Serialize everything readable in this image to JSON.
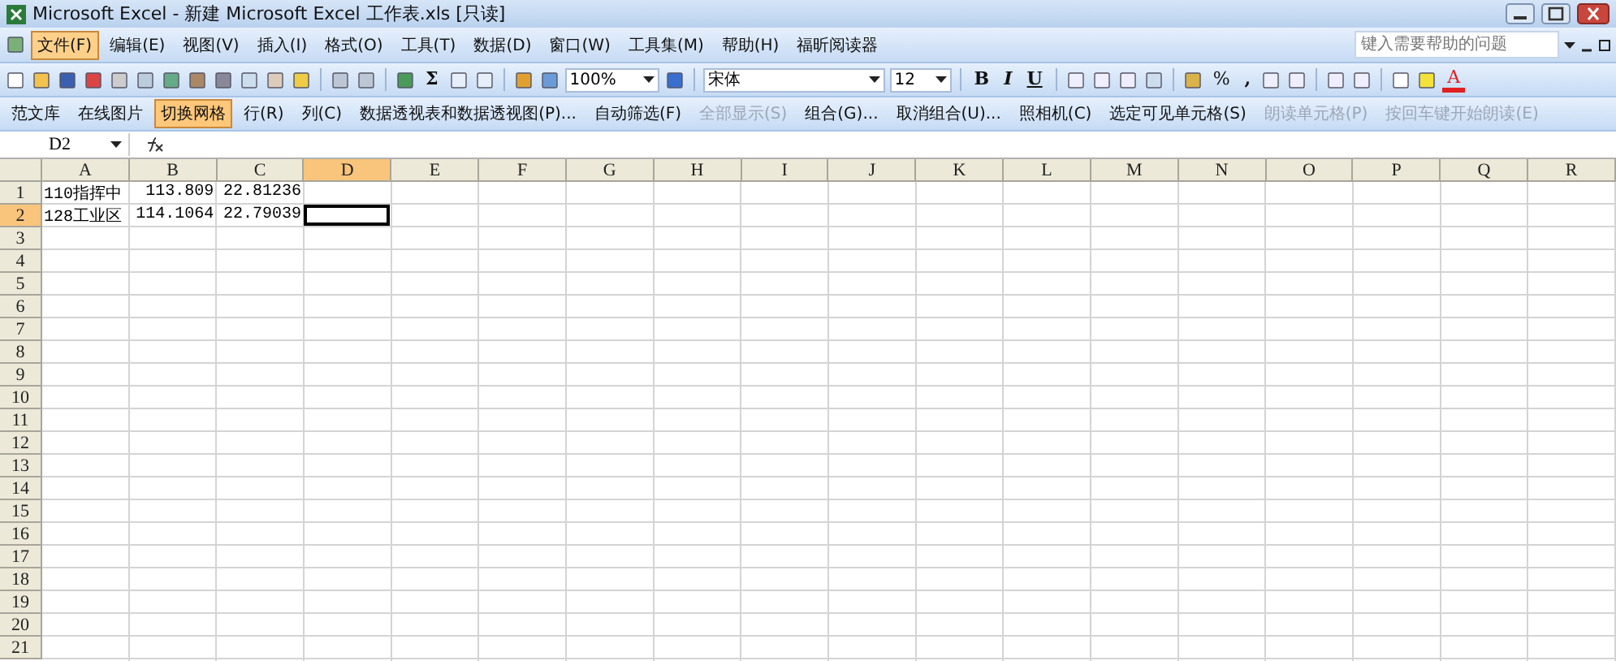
{
  "window": {
    "title": "Microsoft Excel - 新建 Microsoft Excel 工作表.xls  [只读]"
  },
  "menu": [
    {
      "label": "文件(F)",
      "selected": true
    },
    {
      "label": "编辑(E)",
      "selected": false
    },
    {
      "label": "视图(V)",
      "selected": false
    },
    {
      "label": "插入(I)",
      "selected": false
    },
    {
      "label": "格式(O)",
      "selected": false
    },
    {
      "label": "工具(T)",
      "selected": false
    },
    {
      "label": "数据(D)",
      "selected": false
    },
    {
      "label": "窗口(W)",
      "selected": false
    },
    {
      "label": "工具集(M)",
      "selected": false
    },
    {
      "label": "帮助(H)",
      "selected": false
    },
    {
      "label": "福昕阅读器",
      "selected": false
    }
  ],
  "help_search": {
    "placeholder": "键入需要帮助的问题"
  },
  "standard_toolbar": {
    "sum": "Σ",
    "zoom": "100%"
  },
  "formatting_toolbar": {
    "font": "宋体",
    "size": "12",
    "bold": "B",
    "italic": "I",
    "underline": "U",
    "percent": "%",
    "comma": ",",
    "font_color": "A"
  },
  "extra_toolbar": [
    {
      "label": "范文库",
      "selected": false,
      "disabled": false
    },
    {
      "label": "在线图片",
      "selected": false,
      "disabled": false
    },
    {
      "label": "切换网格",
      "selected": true,
      "disabled": false
    },
    {
      "label": "行(R)",
      "selected": false,
      "disabled": false
    },
    {
      "label": "列(C)",
      "selected": false,
      "disabled": false
    },
    {
      "label": "数据透视表和数据透视图(P)...",
      "selected": false,
      "disabled": false
    },
    {
      "label": "自动筛选(F)",
      "selected": false,
      "disabled": false
    },
    {
      "label": "全部显示(S)",
      "selected": false,
      "disabled": true
    },
    {
      "label": "组合(G)...",
      "selected": false,
      "disabled": false
    },
    {
      "label": "取消组合(U)...",
      "selected": false,
      "disabled": false
    },
    {
      "label": "照相机(C)",
      "selected": false,
      "disabled": false
    },
    {
      "label": "选定可见单元格(S)",
      "selected": false,
      "disabled": false
    },
    {
      "label": "朗读单元格(P)",
      "selected": false,
      "disabled": true
    },
    {
      "label": "按回车键开始朗读(E)",
      "selected": false,
      "disabled": true
    }
  ],
  "name_box": {
    "value": "D2"
  },
  "columns": [
    {
      "label": "A",
      "selected": false
    },
    {
      "label": "B",
      "selected": false
    },
    {
      "label": "C",
      "selected": false
    },
    {
      "label": "D",
      "selected": true
    },
    {
      "label": "E",
      "selected": false
    },
    {
      "label": "F",
      "selected": false
    },
    {
      "label": "G",
      "selected": false
    },
    {
      "label": "H",
      "selected": false
    },
    {
      "label": "I",
      "selected": false
    },
    {
      "label": "J",
      "selected": false
    },
    {
      "label": "K",
      "selected": false
    },
    {
      "label": "L",
      "selected": false
    },
    {
      "label": "M",
      "selected": false
    },
    {
      "label": "N",
      "selected": false
    },
    {
      "label": "O",
      "selected": false
    },
    {
      "label": "P",
      "selected": false
    },
    {
      "label": "Q",
      "selected": false
    },
    {
      "label": "R",
      "selected": false
    }
  ],
  "rows": [
    {
      "label": "1",
      "selected": false,
      "cells": [
        {
          "text": "110指挥中",
          "kind": "text"
        },
        {
          "text": "113.809",
          "kind": "number"
        },
        {
          "text": "22.81236",
          "kind": "number"
        }
      ]
    },
    {
      "label": "2",
      "selected": true,
      "cells": [
        {
          "text": "128工业区",
          "kind": "text"
        },
        {
          "text": "114.1064",
          "kind": "number"
        },
        {
          "text": "22.79039",
          "kind": "number"
        }
      ]
    },
    {
      "label": "3",
      "selected": false
    },
    {
      "label": "4",
      "selected": false
    },
    {
      "label": "5",
      "selected": false
    },
    {
      "label": "6",
      "selected": false
    },
    {
      "label": "7",
      "selected": false
    },
    {
      "label": "8",
      "selected": false
    },
    {
      "label": "9",
      "selected": false
    },
    {
      "label": "10",
      "selected": false
    },
    {
      "label": "11",
      "selected": false
    },
    {
      "label": "12",
      "selected": false
    },
    {
      "label": "13",
      "selected": false
    },
    {
      "label": "14",
      "selected": false
    },
    {
      "label": "15",
      "selected": false
    },
    {
      "label": "16",
      "selected": false
    },
    {
      "label": "17",
      "selected": false
    },
    {
      "label": "18",
      "selected": false
    },
    {
      "label": "19",
      "selected": false
    },
    {
      "label": "20",
      "selected": false
    },
    {
      "label": "21",
      "selected": false
    }
  ]
}
